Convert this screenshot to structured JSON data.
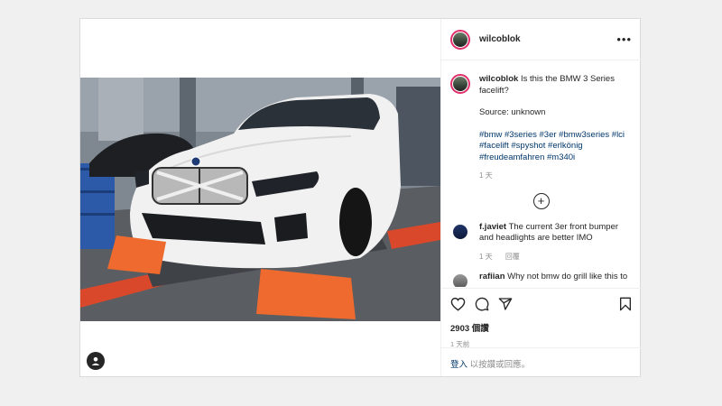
{
  "post": {
    "username": "wilcoblok",
    "more_icon": "more-horizontal-icon",
    "caption_text": "Is this the BMW 3 Series facelift?",
    "source_text": "Source: unknown",
    "hashtags": "#bmw #3series #3er #bmw3series #lci #facelift #spyshot #erlkönig #freudeamfahren #m340i",
    "caption_time": "1 天",
    "load_more_icon": "plus-circle-icon",
    "likes": "2903 個讚",
    "post_time": "1 天前"
  },
  "comments": [
    {
      "username": "f.javiet",
      "text": "The current 3er front bumper and headlights are better IMO",
      "time": "1 天",
      "reply_label": "回覆"
    },
    {
      "username": "rafiian",
      "text": "Why not bmw do grill like this to"
    }
  ],
  "actions": {
    "like_icon": "heart-icon",
    "comment_icon": "comment-icon",
    "share_icon": "share-icon",
    "save_icon": "bookmark-icon"
  },
  "login_bar": {
    "login_link": "登入",
    "suffix": "以按讚或回應。"
  },
  "colors": {
    "link": "#00376b",
    "muted": "#8e8e8e",
    "story_ring": "#e1306c"
  }
}
